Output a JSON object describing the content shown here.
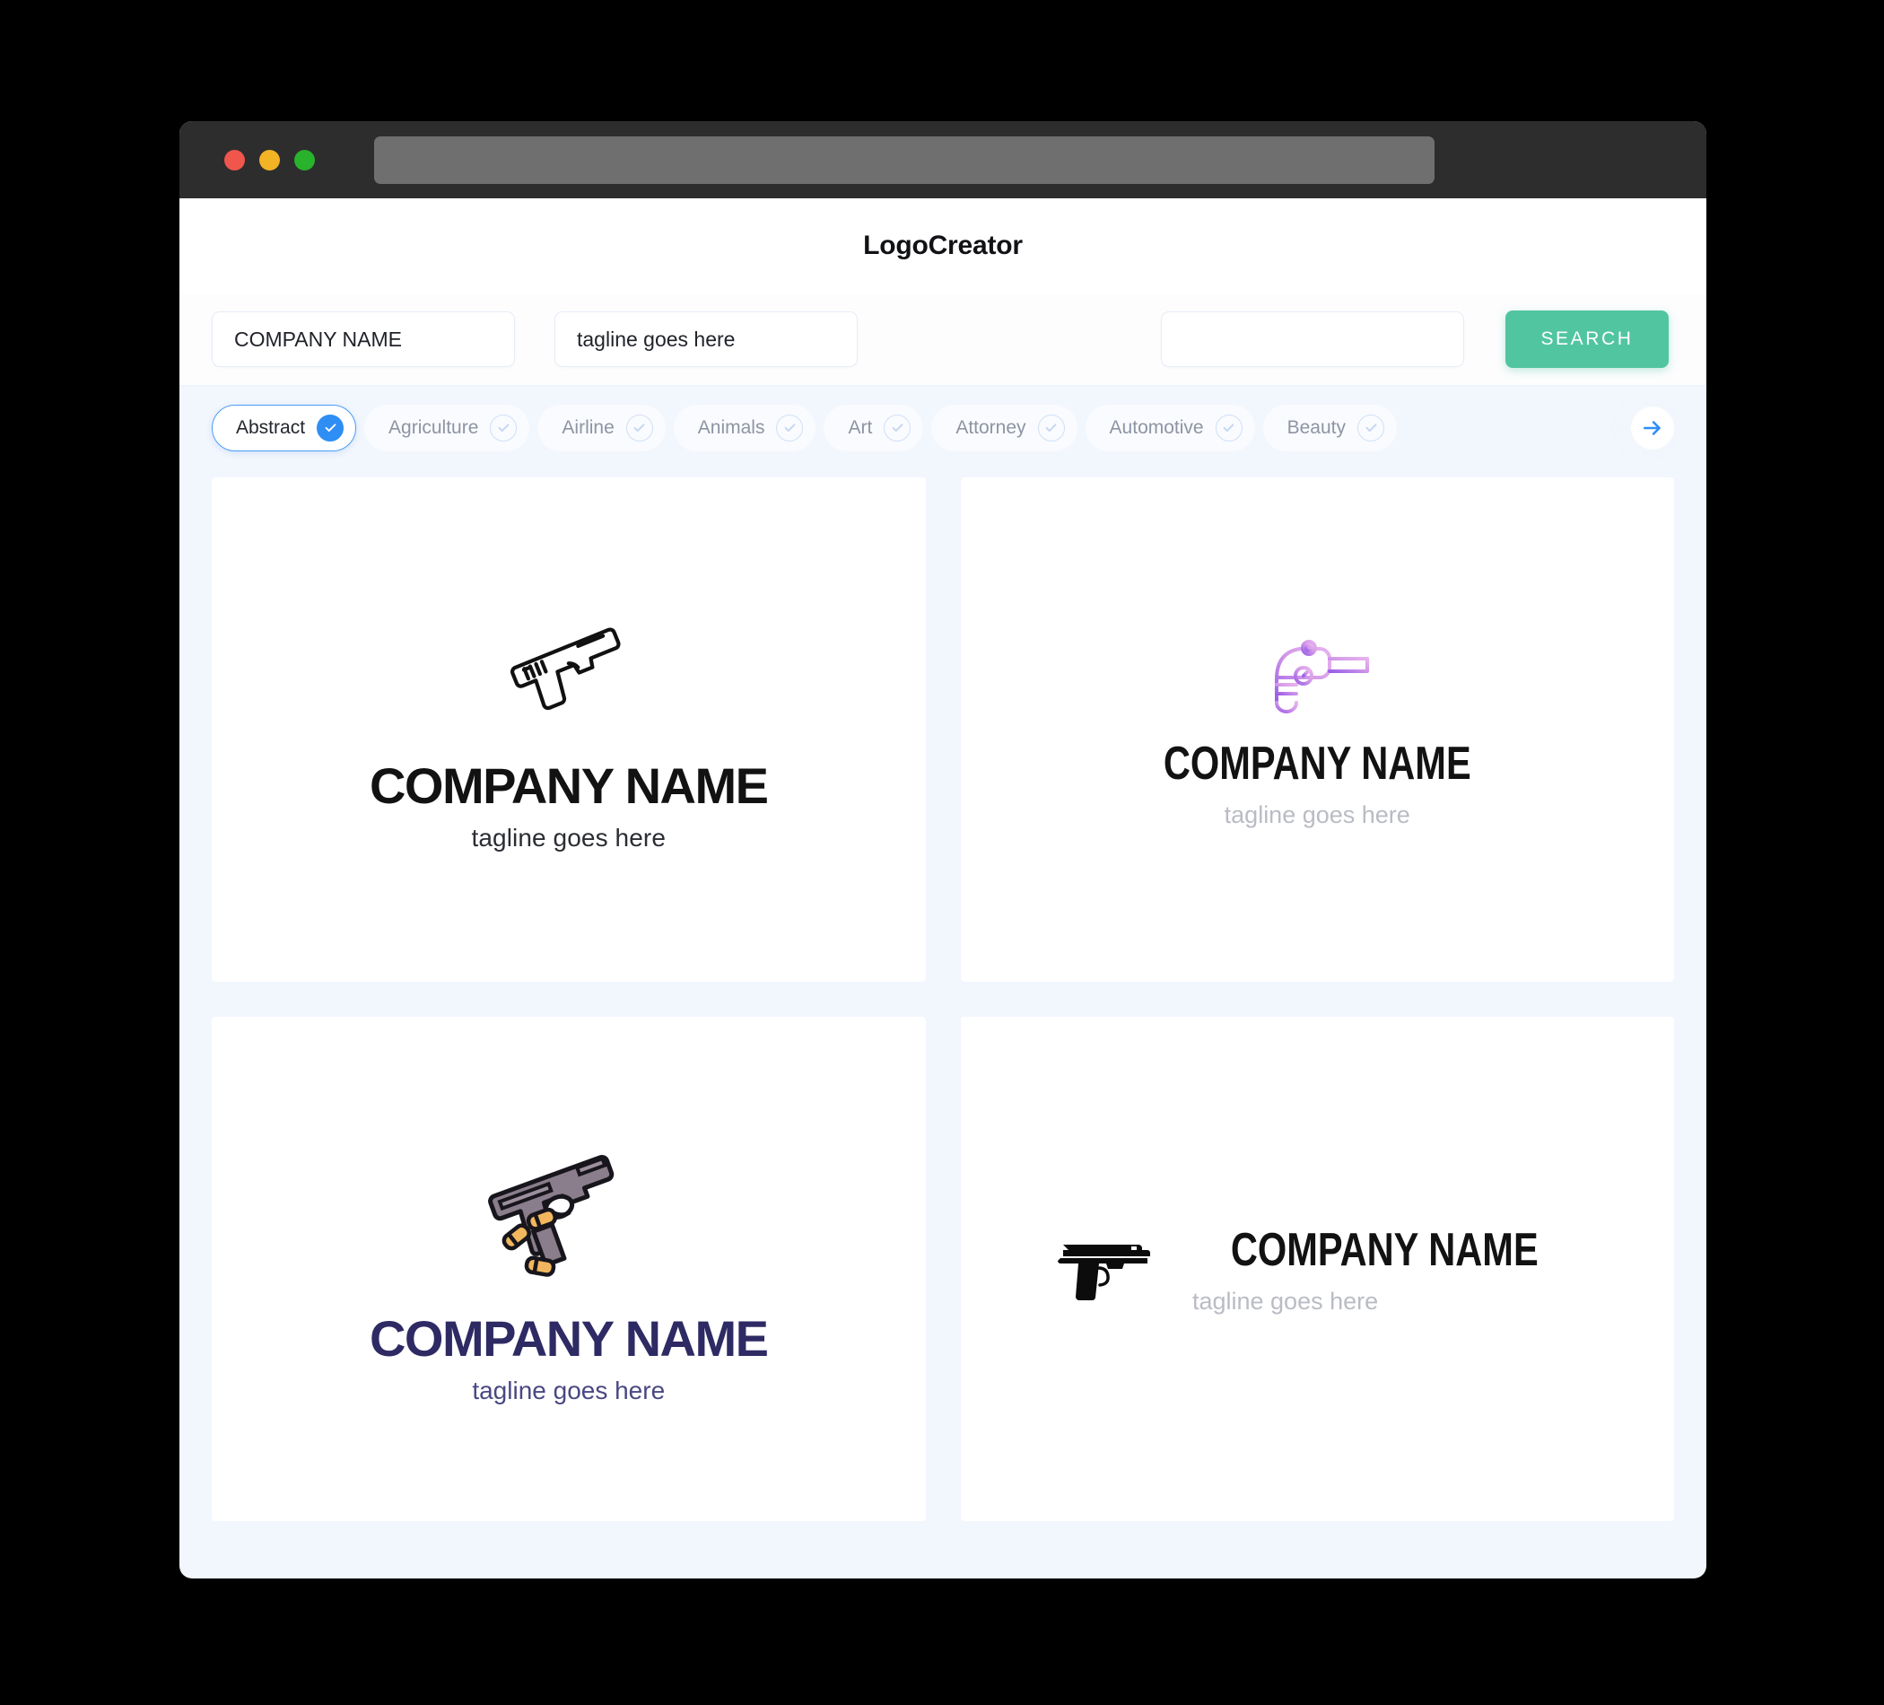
{
  "window": {
    "traffic_lights": [
      "close",
      "minimize",
      "maximize"
    ],
    "address_bar_value": ""
  },
  "header": {
    "title": "LogoCreator"
  },
  "search": {
    "company_value": "COMPANY NAME",
    "tagline_value": "tagline goes here",
    "extra_value": "",
    "extra_placeholder": "",
    "button_label": "SEARCH"
  },
  "categories": {
    "next_icon": "arrow-right-icon",
    "items": [
      {
        "label": "Abstract",
        "selected": true
      },
      {
        "label": "Agriculture",
        "selected": false
      },
      {
        "label": "Airline",
        "selected": false
      },
      {
        "label": "Animals",
        "selected": false
      },
      {
        "label": "Art",
        "selected": false
      },
      {
        "label": "Attorney",
        "selected": false
      },
      {
        "label": "Automotive",
        "selected": false
      },
      {
        "label": "Beauty",
        "selected": false
      }
    ]
  },
  "results": [
    {
      "icon": "pistol-outline-icon",
      "name": "COMPANY NAME",
      "tagline": "tagline goes here",
      "name_color": "#121212",
      "tagline_color": "#2a2d33",
      "layout": "stacked"
    },
    {
      "icon": "flintlock-pistol-outline-icon",
      "name": "COMPANY NAME",
      "tagline": "tagline goes here",
      "name_color": "#121212",
      "tagline_color": "#b9bcc3",
      "layout": "stacked"
    },
    {
      "icon": "pistol-with-bullets-icon",
      "name": "COMPANY NAME",
      "tagline": "tagline goes here",
      "name_color": "#2e2a63",
      "tagline_color": "#4a4882",
      "layout": "stacked"
    },
    {
      "icon": "pistol-solid-icon",
      "name": "COMPANY NAME",
      "tagline": "tagline goes here",
      "name_color": "#121212",
      "tagline_color": "#b9bcc3",
      "layout": "horizontal"
    }
  ],
  "colors": {
    "accent_blue": "#2f8ef4",
    "search_green": "#51c5a0",
    "page_bg": "#f2f6fd",
    "chrome": "#2d2d2e",
    "light_red": "#f0564c",
    "light_yellow": "#f2b324",
    "light_green": "#29b22c",
    "logo_purple": "#b07ae8",
    "logo_pink": "#e8a8e8",
    "gun_body": "#8a7d8c",
    "bullet_gold": "#f0b860"
  }
}
